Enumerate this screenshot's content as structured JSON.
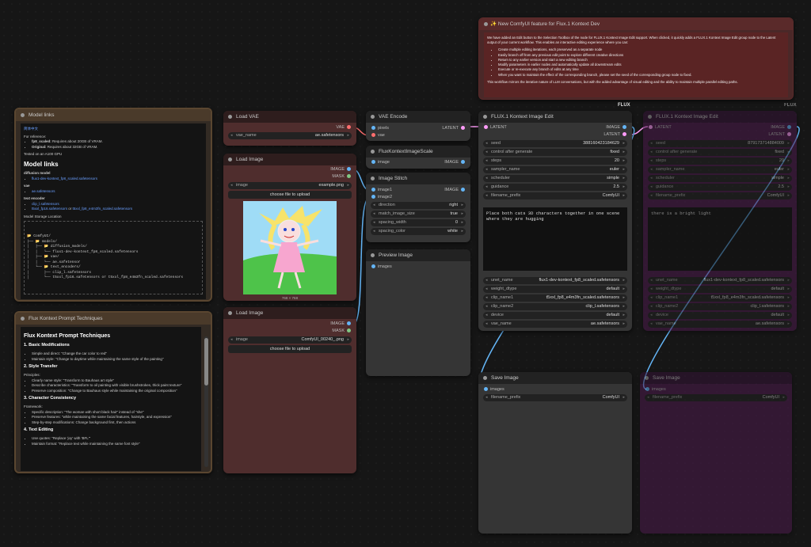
{
  "colors": {
    "canvas": "#161616",
    "image_wire": "#64b5f6",
    "latent_wire": "#ff9cf9",
    "vae_wire": "#ff6e6e",
    "purple_node": "#4b1a4c",
    "red_node": "#4f2d2d"
  },
  "group_labels": {
    "flux": "FLUX",
    "flux2": "FLUX"
  },
  "model_links": {
    "title": "Model links",
    "link_top": "简体中文",
    "for_reference": "For reference:",
    "ref": [
      {
        "b": "fp8_scaled:",
        "t": " Requires about 20GB of VRAM."
      },
      {
        "b": "Original:",
        "t": " Requires about 32GB of VRAM."
      }
    ],
    "tested": "Tested on an A100 GPU",
    "heading": "Model links",
    "diff_label": "diffusion model",
    "diff_file": "flux1-dev-kontext_fp8_scaled.safetensors",
    "vae_label": "vae",
    "vae_file": "ae.safetensors",
    "te_label": "text encoder",
    "te_file1": "clip_l.safetensors",
    "te_file2": "t5xxl_fp16.safetensors",
    "te_or": " or ",
    "te_file3": "t5xxl_fp8_e4m3fn_scaled.safetensors",
    "storage": "Model Storage Location",
    "tree": [
      "📂 ComfyUI/",
      "├── 📂 models/",
      "│   ├── 📂 diffusion_models/",
      "│   │   └── flux1-dev-kontext_fp8_scaled.safetensors",
      "│   ├── 📂 vae/",
      "│   │   └── ae.safetensor",
      "│   └── 📂 text_encoders/",
      "│       ├── clip_l.safetensors",
      "│       └── t5xxl_fp16.safetensors or t5xxl_fp8_e4m3fn_scaled.safetensors"
    ]
  },
  "tech": {
    "title": "Flux Kontext Prompt Techniques",
    "heading": "Flux Kontext Prompt Techniques",
    "s1": "1. Basic Modifications",
    "s1_items": [
      "Simple and direct: \"Change the car color to red\"",
      "Maintain style: \"Change to daytime while maintaining the same style of the painting\""
    ],
    "s2": "2. Style Transfer",
    "s2_label": "Principles:",
    "s2_items": [
      "Clearly name style: \"Transform to Bauhaus art style\"",
      "Describe characteristics: \"Transform to oil painting with visible brushstrokes, thick paint texture\"",
      "Preserve composition: \"Change to Bauhaus style while maintaining the original composition\""
    ],
    "s3": "3. Character Consistency",
    "s3_label": "Framework:",
    "s3_items": [
      "Specific description: \"The woman with short black hair\" instead of \"she\"",
      "Preserve features: \"while maintaining the same facial features, hairstyle, and expression\"",
      "Step-by-step modifications: Change background first, then actions"
    ],
    "s4": "4. Text Editing",
    "s4_items": [
      "Use quotes: \"Replace 'joy' with 'BFL'\"",
      "Maintain format: \"Replace text while maintaining the same font style\""
    ]
  },
  "load_vae": {
    "title": "Load VAE",
    "out": "VAE",
    "w_key": "vae_name",
    "w_val": "ae.safetensors"
  },
  "load_image1": {
    "title": "Load Image",
    "out1": "IMAGE",
    "out2": "MASK",
    "w_key": "image",
    "w_val": "example.png",
    "upload": "choose file to upload",
    "size": "768 × 768"
  },
  "load_image2": {
    "title": "Load Image",
    "out1": "IMAGE",
    "out2": "MASK",
    "w_key": "image",
    "w_val": "ComfyUI_00240_.png",
    "upload": "choose file to upload"
  },
  "vae_encode": {
    "title": "VAE Encode",
    "in1": "pixels",
    "in2": "vae",
    "out": "LATENT"
  },
  "scale": {
    "title": "FluxKontextImageScale",
    "in": "image",
    "out": "IMAGE"
  },
  "stitch": {
    "title": "Image Stitch",
    "in1": "image1",
    "in2": "image2",
    "out": "IMAGE",
    "widgets": [
      {
        "k": "direction",
        "v": "right"
      },
      {
        "k": "match_image_size",
        "v": "true"
      },
      {
        "k": "spacing_width",
        "v": "0"
      },
      {
        "k": "spacing_color",
        "v": "white"
      }
    ]
  },
  "preview": {
    "title": "Preview Image",
    "in": "images"
  },
  "note": {
    "title": "✨ New ComfyUI feature for Flux.1 Kontext Dev",
    "p1": "We have added an Edit button to the Selection Toolbox of the node for FLUX.1 Kontext Image Edit support. When clicked, it quickly adds a FLUX.1 Kontext Image Edit group node to the Latent output of your current workflow. This enables an interactive editing experience where you can:",
    "items": [
      "Create multiple editing iterations, each preserved as a separate node",
      "Easily branch off from any previous edit point to explore different creative directions",
      "Return to any earlier version and start a new editing branch",
      "Modify parameters in earlier nodes and automatically update all downstream edits",
      "Execute or re-execute any branch of edits at any time",
      "When you want to maintain the effect of the corresponding branch, please set the seed of the corresponding group node to fixed."
    ],
    "p2": "This workflow mirrors the iterative nature of LLM conversations, but with the added advantage of visual editing and the ability to maintain multiple parallel editing paths."
  },
  "edit1": {
    "title": "FLUX.1 Kontext Image Edit",
    "in": "LATENT",
    "out1": "IMAGE",
    "out2": "LATENT",
    "widgets": [
      {
        "k": "seed",
        "v": "388160423184629"
      },
      {
        "k": "control after generate",
        "v": "fixed"
      },
      {
        "k": "steps",
        "v": "20"
      },
      {
        "k": "sampler_name",
        "v": "euler"
      },
      {
        "k": "scheduler",
        "v": "simple"
      },
      {
        "k": "guidance",
        "v": "2.5"
      },
      {
        "k": "filename_prefix",
        "v": "ComfyUI"
      }
    ],
    "prompt": "Place both cats 3D characters together in one scene where they are hugging",
    "widgets2": [
      {
        "k": "unet_name",
        "v": "flux1-dev-kontext_fp8_scaled.safetensors"
      },
      {
        "k": "weight_dtype",
        "v": "default"
      },
      {
        "k": "clip_name1",
        "v": "t5xxl_fp8_e4m3fn_scaled.safetensors"
      },
      {
        "k": "clip_name2",
        "v": "clip_l.safetensors"
      },
      {
        "k": "device",
        "v": "default"
      },
      {
        "k": "vae_name",
        "v": "ae.safetensors"
      }
    ]
  },
  "edit2": {
    "title": "FLUX.1 Kontext Image Edit",
    "in": "LATENT",
    "out1": "IMAGE",
    "out2": "LATENT",
    "widgets": [
      {
        "k": "seed",
        "v": "879173714884009"
      },
      {
        "k": "control after generate",
        "v": "fixed"
      },
      {
        "k": "steps",
        "v": "20"
      },
      {
        "k": "sampler_name",
        "v": "euler"
      },
      {
        "k": "scheduler",
        "v": "simple"
      },
      {
        "k": "guidance",
        "v": "2.5"
      },
      {
        "k": "filename_prefix",
        "v": "ComfyUI"
      }
    ],
    "prompt": "there is a bright light",
    "widgets2": [
      {
        "k": "unet_name",
        "v": "flux1-dev-kontext_fp8_scaled.safetensors"
      },
      {
        "k": "weight_dtype",
        "v": "default"
      },
      {
        "k": "clip_name1",
        "v": "t5xxl_fp8_e4m3fn_scaled.safetensors"
      },
      {
        "k": "clip_name2",
        "v": "clip_l.safetensors"
      },
      {
        "k": "device",
        "v": "default"
      },
      {
        "k": "vae_name",
        "v": "ae.safetensors"
      }
    ]
  },
  "save1": {
    "title": "Save Image",
    "in": "images",
    "w_key": "filename_prefix",
    "w_val": "ComfyUI"
  },
  "save2": {
    "title": "Save Image",
    "in": "images",
    "w_key": "filename_prefix",
    "w_val": "ComfyUI"
  }
}
